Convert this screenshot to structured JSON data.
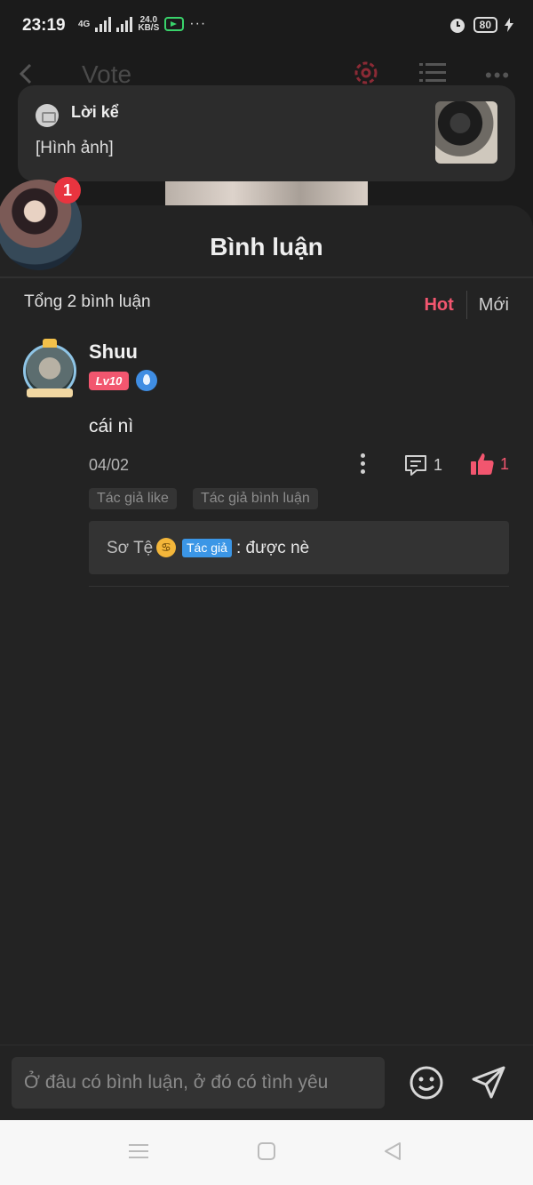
{
  "status_bar": {
    "time": "23:19",
    "network_label": "4G",
    "speed_value": "24.0",
    "speed_unit": "KB/S",
    "more_indicator": "···",
    "battery_level": "80",
    "icons": [
      "signal-icon",
      "signal-icon",
      "app-notification-icon",
      "alarm-icon",
      "battery-icon",
      "charging-icon"
    ]
  },
  "app_bar": {
    "title": "Vote",
    "icons": [
      "back-arrow-icon",
      "gear-icon",
      "list-icon",
      "more-icon"
    ]
  },
  "notification": {
    "app_name": "Lời kể",
    "body": "[Hình ảnh]"
  },
  "floating_avatar": {
    "badge_count": "1"
  },
  "comments": {
    "title": "Bình luận",
    "total_label": "Tổng 2 bình luận",
    "sort_options": [
      "Hot",
      "Mới"
    ],
    "active_sort": "Hot",
    "items": [
      {
        "user": "Shuu",
        "level": "Lv10",
        "text": "cái nì",
        "date": "04/02",
        "reply_count": "1",
        "like_count": "1",
        "tags": [
          "Tác giả like",
          "Tác giả bình luận"
        ],
        "reply": {
          "user": "Sơ Tệ",
          "zodiac_symbol": "♋",
          "author_badge": "Tác giả",
          "text": ": được nè"
        }
      }
    ]
  },
  "input_bar": {
    "placeholder": "Ở đâu có bình luận, ở đó có tình yêu"
  },
  "colors": {
    "accent": "#f2566f",
    "badge_red": "#e8343f",
    "author_blue": "#3b96e6",
    "background": "#232323"
  }
}
